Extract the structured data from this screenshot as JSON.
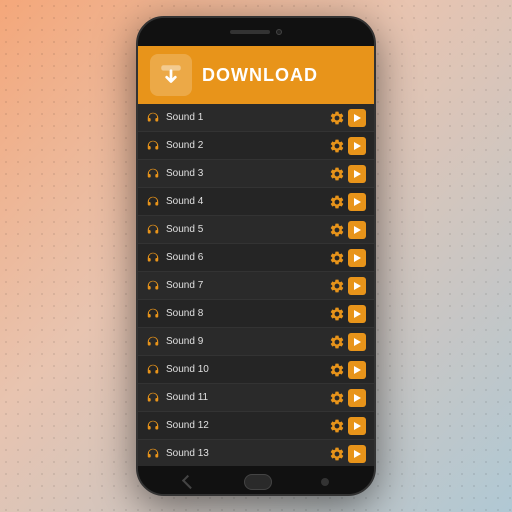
{
  "banner": {
    "text": "DOWNLOAD"
  },
  "sounds": [
    {
      "id": 1,
      "name": "Sound 1"
    },
    {
      "id": 2,
      "name": "Sound 2"
    },
    {
      "id": 3,
      "name": "Sound 3"
    },
    {
      "id": 4,
      "name": "Sound 4"
    },
    {
      "id": 5,
      "name": "Sound 5"
    },
    {
      "id": 6,
      "name": "Sound 6"
    },
    {
      "id": 7,
      "name": "Sound 7"
    },
    {
      "id": 8,
      "name": "Sound 8"
    },
    {
      "id": 9,
      "name": "Sound 9"
    },
    {
      "id": 10,
      "name": "Sound 10"
    },
    {
      "id": 11,
      "name": "Sound 11"
    },
    {
      "id": 12,
      "name": "Sound 12"
    },
    {
      "id": 13,
      "name": "Sound 13"
    }
  ],
  "colors": {
    "accent": "#e8941a"
  }
}
